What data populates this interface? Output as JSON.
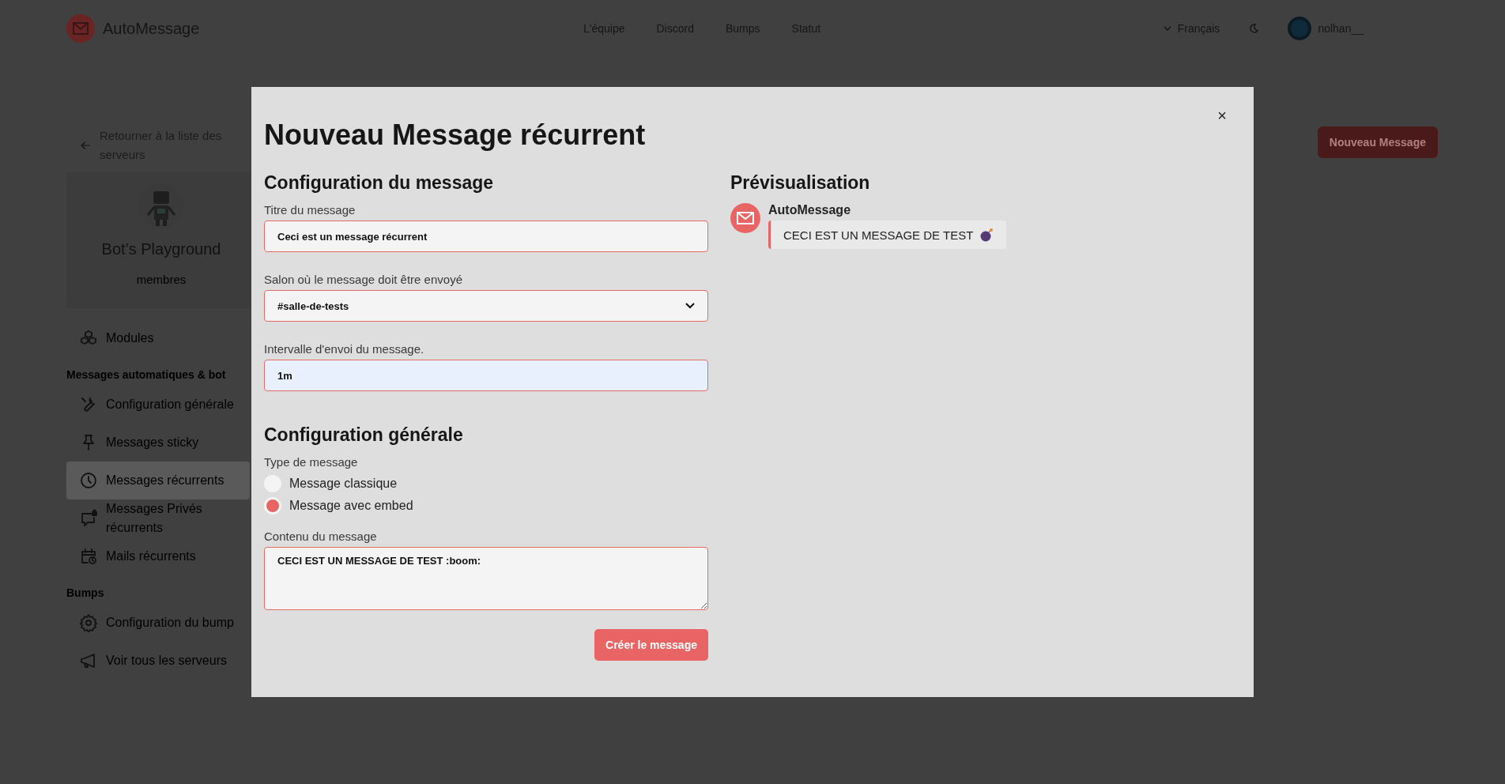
{
  "header": {
    "brand": "AutoMessage",
    "nav": [
      {
        "label": "L'équipe"
      },
      {
        "label": "Discord"
      },
      {
        "label": "Bumps"
      },
      {
        "label": "Statut"
      }
    ],
    "language": "Français",
    "user": "nolhan__"
  },
  "sidebar": {
    "back_link": "Retourner à la liste des serveurs",
    "server": {
      "name": "Bot’s Playground",
      "members": "membres"
    },
    "items": [
      {
        "kind": "item",
        "label": "Modules",
        "selected": false
      },
      {
        "kind": "section",
        "label": "Messages automatiques & bot"
      },
      {
        "kind": "item",
        "label": "Configuration générale",
        "selected": false
      },
      {
        "kind": "item",
        "label": "Messages sticky",
        "selected": false
      },
      {
        "kind": "item",
        "label": "Messages récurrents",
        "selected": true
      },
      {
        "kind": "item",
        "label": "Messages Privés récurrents",
        "selected": false
      },
      {
        "kind": "item",
        "label": "Mails récurrents",
        "selected": false
      },
      {
        "kind": "section",
        "label": "Bumps"
      },
      {
        "kind": "item",
        "label": "Configuration du bump",
        "selected": false
      },
      {
        "kind": "item",
        "label": "Voir tous les serveurs",
        "selected": false
      }
    ]
  },
  "main": {
    "new_button": "Nouveau Message"
  },
  "modal": {
    "title": "Nouveau Message récurrent",
    "close": "×",
    "message_config": {
      "heading": "Configuration du message",
      "fields": [
        {
          "kind": "text",
          "label": "Titre du message",
          "value": "Ceci est un message récurrent",
          "autofilled": false
        },
        {
          "kind": "select",
          "label": "Salon où le message doit être envoyé",
          "value": "#salle-de-tests",
          "autofilled": false
        },
        {
          "kind": "text",
          "label": "Intervalle d'envoi du message.",
          "value": "1m",
          "autofilled": true
        }
      ]
    },
    "general_config": {
      "heading": "Configuration générale",
      "type_label": "Type de message",
      "options": [
        {
          "label": "Message classique",
          "selected": false
        },
        {
          "label": "Message avec embed",
          "selected": true
        }
      ],
      "content_label": "Contenu du message",
      "content": "CECI EST UN MESSAGE DE TEST :boom:"
    },
    "submit": "Créer le message",
    "preview": {
      "heading": "Prévisualisation",
      "author": "AutoMessage",
      "embed_text": "CECI EST UN MESSAGE DE TEST"
    }
  }
}
